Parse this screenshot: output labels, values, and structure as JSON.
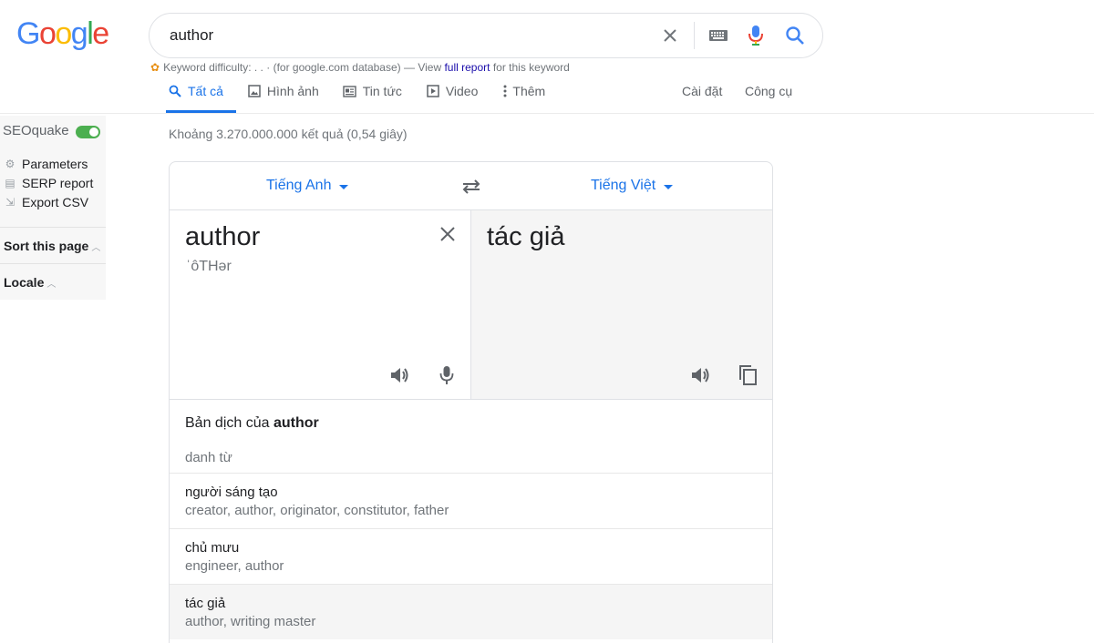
{
  "logo": {
    "letters": [
      "G",
      "o",
      "o",
      "g",
      "l",
      "e"
    ],
    "colors": [
      "#4285f4",
      "#ea4335",
      "#fbbc05",
      "#4285f4",
      "#34a853",
      "#ea4335"
    ]
  },
  "search": {
    "value": "author",
    "icons": [
      "close-icon",
      "keyboard-icon",
      "mic-icon",
      "search-icon"
    ]
  },
  "keyword_bar": {
    "prefix": "Keyword difficulty: ",
    "dots": ". . ·",
    "middle": " (for google.com database) — View ",
    "link": "full report",
    "suffix": " for this keyword"
  },
  "tabs": [
    {
      "label": "Tất cả",
      "icon": "search-icon",
      "active": true
    },
    {
      "label": "Hình ảnh",
      "icon": "image-icon",
      "active": false
    },
    {
      "label": "Tin tức",
      "icon": "news-icon",
      "active": false
    },
    {
      "label": "Video",
      "icon": "video-icon",
      "active": false
    },
    {
      "label": "Thêm",
      "icon": "more-vertical-icon",
      "active": false
    }
  ],
  "settings_label": "Cài đặt",
  "tools_label": "Công cụ",
  "seoquake": {
    "title": "SEOquake",
    "toggle_on": true,
    "items": [
      {
        "label": "Parameters",
        "icon": "gear-icon"
      },
      {
        "label": "SERP report",
        "icon": "report-icon"
      },
      {
        "label": "Export CSV",
        "icon": "export-icon"
      }
    ],
    "sort_label": "Sort this page",
    "locale_label": "Locale"
  },
  "result_stats": "Khoảng 3.270.000.000 kết quả (0,54 giây)",
  "translate": {
    "source_lang": "Tiếng Anh",
    "target_lang": "Tiếng Việt",
    "source_text": "author",
    "phonetic": "ˈôTHər",
    "target_text": "tác giả",
    "dict_prefix": "Bản dịch của ",
    "dict_word": "author",
    "pos": "danh từ",
    "entries": [
      {
        "word": "người sáng tạo",
        "synonyms": "creator, author, originator, constitutor, father",
        "highlight": false
      },
      {
        "word": "chủ mưu",
        "synonyms": "engineer, author",
        "highlight": false
      },
      {
        "word": "tác giả",
        "synonyms": "author, writing master",
        "highlight": true
      }
    ]
  },
  "colors": {
    "accent": "#1a73e8",
    "toggle": "#4caf50",
    "link": "#1a0dab"
  }
}
